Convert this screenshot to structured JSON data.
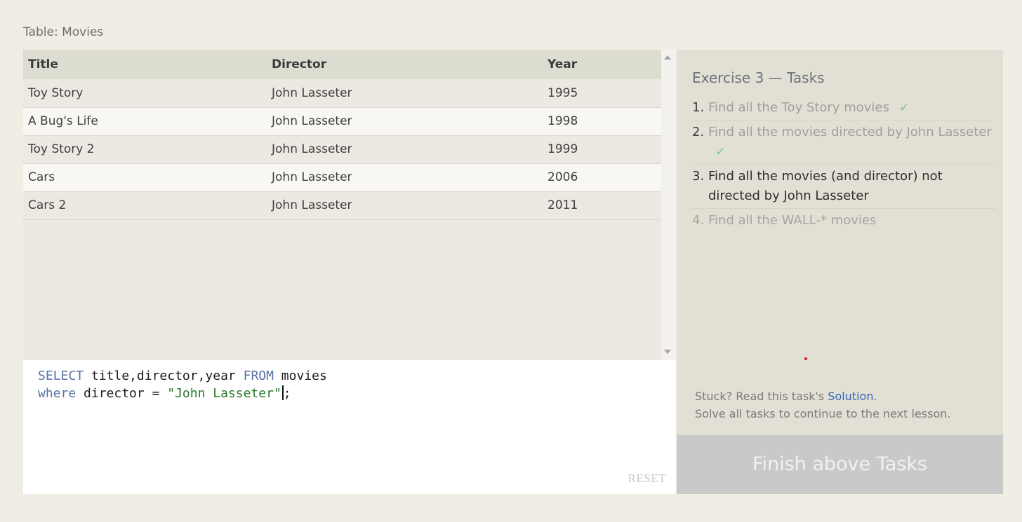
{
  "table": {
    "caption": "Table: Movies",
    "columns": [
      "Title",
      "Director",
      "Year"
    ],
    "rows": [
      [
        "Toy Story",
        "John Lasseter",
        "1995"
      ],
      [
        "A Bug's Life",
        "John Lasseter",
        "1998"
      ],
      [
        "Toy Story 2",
        "John Lasseter",
        "1999"
      ],
      [
        "Cars",
        "John Lasseter",
        "2006"
      ],
      [
        "Cars 2",
        "John Lasseter",
        "2011"
      ]
    ]
  },
  "editor": {
    "line1": {
      "kw1": "SELECT",
      "text1": " title,director,year ",
      "kw2": "FROM",
      "text2": " movies"
    },
    "line2": {
      "kw1": "where",
      "text1": " director = ",
      "string": "\"John Lasseter\"",
      "text2": ";"
    },
    "reset_label": "RESET"
  },
  "exercise": {
    "title": "Exercise 3 — Tasks",
    "check_mark": "✓",
    "tasks": [
      {
        "num": "1.",
        "text": "Find all the Toy Story movies",
        "status": "done"
      },
      {
        "num": "2.",
        "text": "Find all the movies directed by John Lasseter",
        "status": "done"
      },
      {
        "num": "3.",
        "text": "Find all the movies (and director) not directed by John Lasseter",
        "status": "current"
      },
      {
        "num": "4.",
        "text": "Find all the WALL-* movies",
        "status": "todo"
      }
    ]
  },
  "help": {
    "stuck_prefix": "Stuck? Read this task's ",
    "solution_link": "Solution",
    "stuck_suffix": ".",
    "continue_text": "Solve all tasks to continue to the next lesson."
  },
  "finish_button": "Finish above Tasks",
  "colors": {
    "background": "#f0ede5",
    "keyword": "#5770a6",
    "string": "#2a7a2a",
    "check": "#7cc88a",
    "link": "#3767bd",
    "finish_bg": "#c9c9c9"
  }
}
